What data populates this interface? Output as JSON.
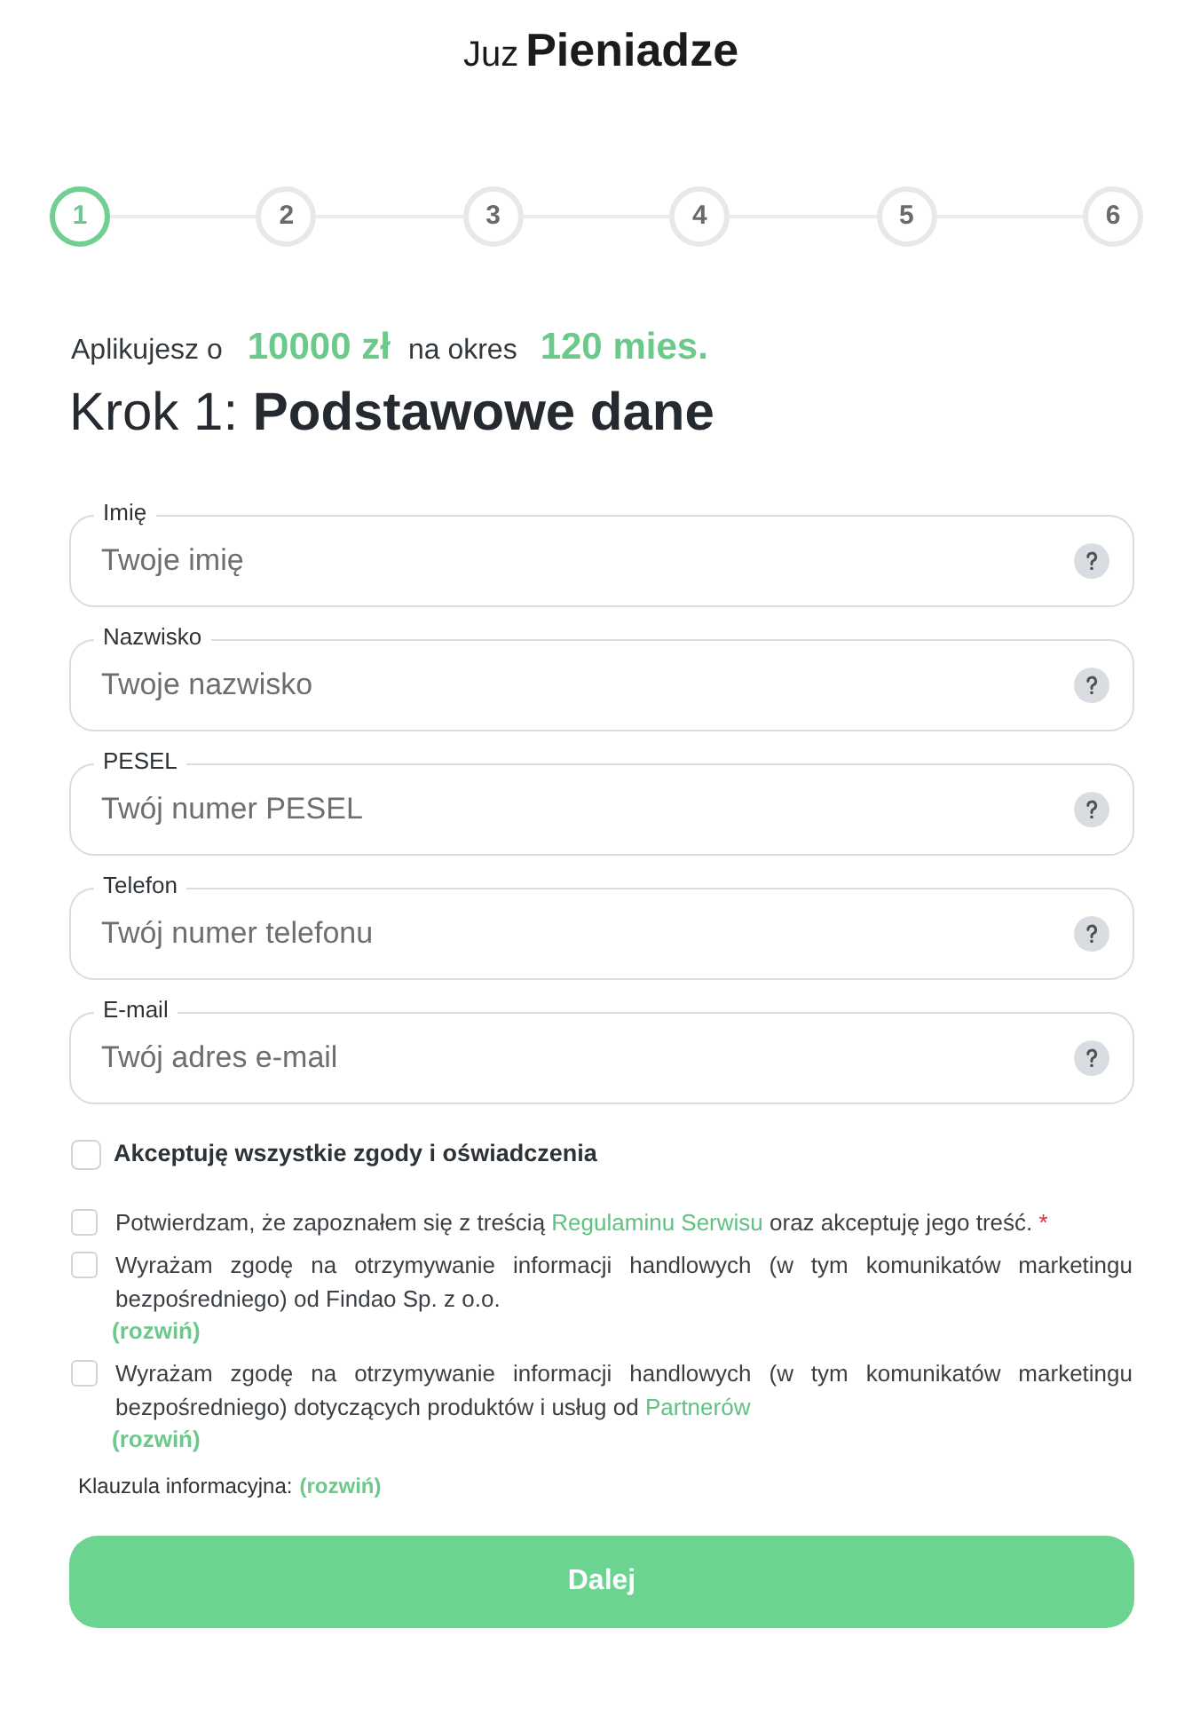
{
  "logo": {
    "light": "Juz",
    "bold": "Pieniadze"
  },
  "steps": [
    {
      "label": "1",
      "selected": true
    },
    {
      "label": "2",
      "selected": false
    },
    {
      "label": "3",
      "selected": false
    },
    {
      "label": "4",
      "selected": false
    },
    {
      "label": "5",
      "selected": false
    },
    {
      "label": "6",
      "selected": false
    }
  ],
  "summary": {
    "prefix": "Aplikujesz o",
    "amount": "10000 zł",
    "middle": "na okres",
    "period": "120 mies."
  },
  "heading": {
    "step": "Krok 1:",
    "title": "Podstawowe dane"
  },
  "fields": [
    {
      "label": "Imię",
      "placeholder": "Twoje imię"
    },
    {
      "label": "Nazwisko",
      "placeholder": "Twoje nazwisko"
    },
    {
      "label": "PESEL",
      "placeholder": "Twój numer PESEL"
    },
    {
      "label": "Telefon",
      "placeholder": "Twój numer telefonu"
    },
    {
      "label": "E-mail",
      "placeholder": "Twój adres e-mail"
    }
  ],
  "accept_all": {
    "label": "Akceptuję wszystkie zgody i oświadczenia",
    "checked": false
  },
  "consents": [
    {
      "text": "Potwierdzam, że zapoznałem się z treścią",
      "link": "Regulaminu Serwisu",
      "text_after": "oraz akceptuję jego treść.",
      "required_mark": "*",
      "checked": false
    },
    {
      "text": "Wyrażam zgodę na otrzymywanie informacji handlowych (w tym komunikatów marketingu bezpośredniego) od Findao Sp. z o.o.",
      "expand": "(rozwiń)",
      "checked": false
    },
    {
      "text": "Wyrażam zgodę na otrzymywanie informacji handlowych (w tym komunikatów marketingu bezpośredniego) dotyczących produktów i usług od",
      "link": "Partnerów",
      "expand": "(rozwiń)",
      "checked": false
    }
  ],
  "info_clause": {
    "label": "Klauzula informacyjna:",
    "link": "(rozwiń)"
  },
  "button": "Dalej"
}
